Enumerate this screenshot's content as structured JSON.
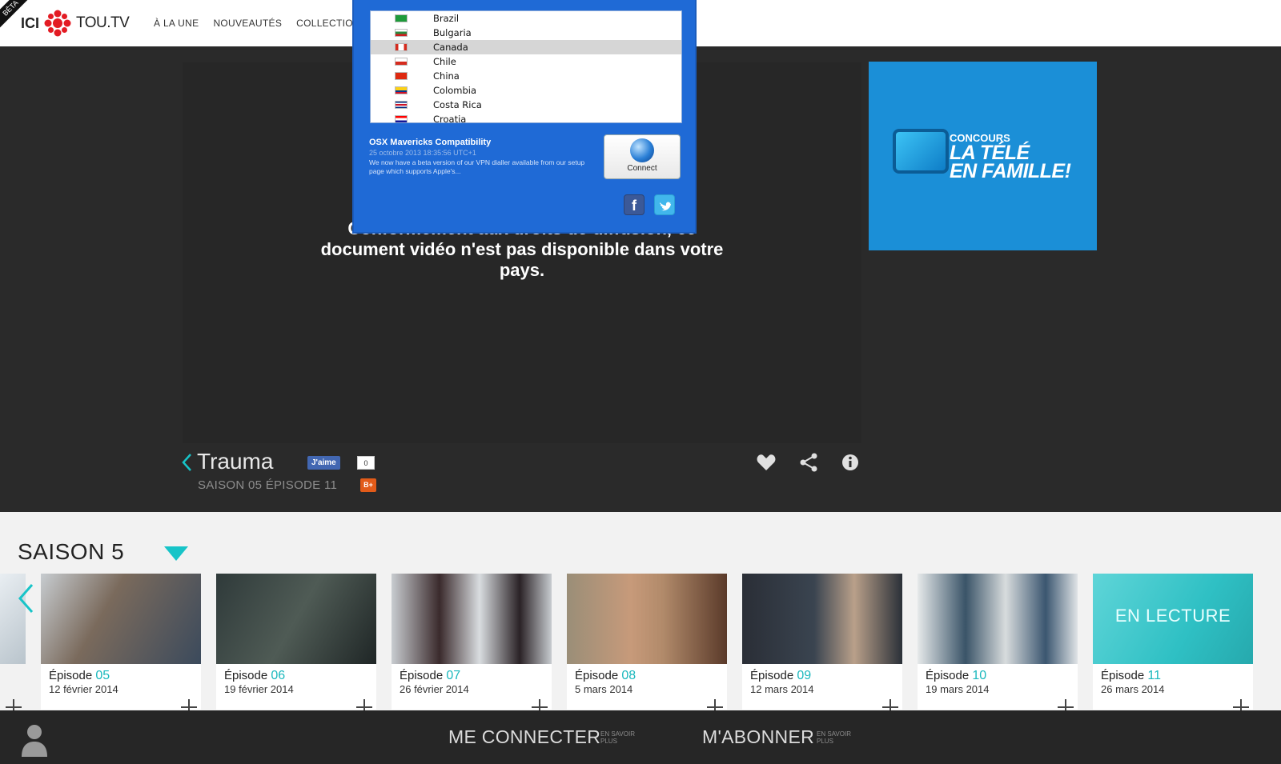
{
  "header": {
    "beta": "BÊTA",
    "logo_ici": "ICI",
    "logo_tou": "TOU.TV",
    "nav": [
      "À LA UNE",
      "NOUVEAUTÉS",
      "COLLECTION"
    ]
  },
  "vpn": {
    "countries": [
      {
        "name": "Brazil",
        "flag": "#1e9b3a"
      },
      {
        "name": "Bulgaria",
        "flag": "#2a8a3e"
      },
      {
        "name": "Canada",
        "flag": "#d52b1e"
      },
      {
        "name": "Chile",
        "flag": "#d52b1e"
      },
      {
        "name": "China",
        "flag": "#de2910"
      },
      {
        "name": "Colombia",
        "flag": "#fcd116"
      },
      {
        "name": "Costa Rica",
        "flag": "#002b7f"
      },
      {
        "name": "Croatia",
        "flag": "#ff0000"
      }
    ],
    "selected": "Canada",
    "news_title": "OSX Mavericks Compatibility",
    "news_date": "25 octobre 2013 18:35:56 UTC+1",
    "news_body": "We now have a beta version of our VPN dialler available from our setup page which supports Apple's...",
    "connect_label": "Connect",
    "facebook_icon": "facebook-icon",
    "twitter_icon": "twitter-icon"
  },
  "player": {
    "geo_message": "Conformément aux droits de diffusion, ce document vidéo n'est pas disponible dans votre pays."
  },
  "ad": {
    "concours": "CONCOURS",
    "line1": "LA TÉLÉ",
    "line2": "EN FAMILLE!"
  },
  "show": {
    "title": "Trauma",
    "fb_like": "J'aime",
    "fb_count": "0",
    "subtitle": "SAISON 05 ÉPISODE 11",
    "gplus": "B+"
  },
  "season": {
    "title": "SAISON 5",
    "episodes": [
      {
        "label": "Épisode",
        "num": "05",
        "date": "12 février 2014",
        "thumb": "#5b6b7a"
      },
      {
        "label": "Épisode",
        "num": "06",
        "date": "19 février 2014",
        "thumb": "#3a4a4a"
      },
      {
        "label": "Épisode",
        "num": "07",
        "date": "26 février 2014",
        "thumb": "#b7bcc2"
      },
      {
        "label": "Épisode",
        "num": "08",
        "date": "5 mars 2014",
        "thumb": "#8a6a55"
      },
      {
        "label": "Épisode",
        "num": "09",
        "date": "12 mars 2014",
        "thumb": "#4a5560"
      },
      {
        "label": "Épisode",
        "num": "10",
        "date": "19 mars 2014",
        "thumb": "#c6ccd0"
      },
      {
        "label": "Épisode",
        "num": "11",
        "date": "26 mars 2014",
        "thumb": "#2fc6c8",
        "overlay": "EN LECTURE"
      }
    ]
  },
  "footer": {
    "connect": "ME CONNECTER",
    "connect_small": "EN SAVOIR PLUS",
    "subscribe": "M'ABONNER",
    "subscribe_small": "EN SAVOIR PLUS"
  },
  "colors": {
    "accent": "#17c4c8",
    "vpn_blue": "#1f6ad6",
    "ad_blue": "#1b8fd7"
  }
}
